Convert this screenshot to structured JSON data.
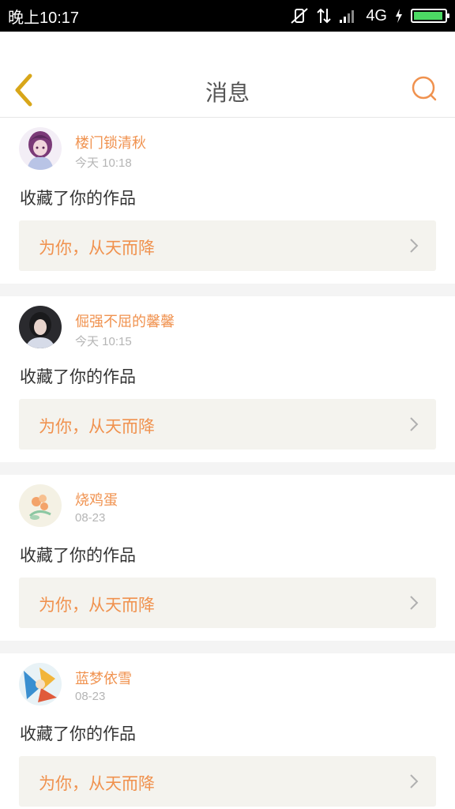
{
  "status_bar": {
    "time": "晚上10:17",
    "network": "4G",
    "battery_level": 0.95,
    "icons": [
      "vibrate-off-icon",
      "data-arrows-icon",
      "signal-icon",
      "charging-icon",
      "battery-icon"
    ]
  },
  "header": {
    "title": "消息",
    "back_icon": "back-chevron-icon",
    "search_icon": "search-icon"
  },
  "colors": {
    "accent": "#f0924f",
    "back_icon": "#d8a619",
    "card_bg": "#f4f3ee",
    "separator": "#f4f4f4"
  },
  "messages": [
    {
      "user": "楼门锁清秋",
      "time": "今天 10:18",
      "action": "收藏了你的作品",
      "work_title": "为你，从天而降",
      "avatar": "purple-anime-avatar"
    },
    {
      "user": "倔强不屈的馨馨",
      "time": "今天 10:15",
      "action": "收藏了你的作品",
      "work_title": "为你，从天而降",
      "avatar": "photo-avatar"
    },
    {
      "user": "烧鸡蛋",
      "time": "08-23",
      "action": "收藏了你的作品",
      "work_title": "为你，从天而降",
      "avatar": "flower-avatar"
    },
    {
      "user": "蓝梦依雪",
      "time": "08-23",
      "action": "收藏了你的作品",
      "work_title": "为你，从天而降",
      "avatar": "colorful-art-avatar"
    }
  ]
}
